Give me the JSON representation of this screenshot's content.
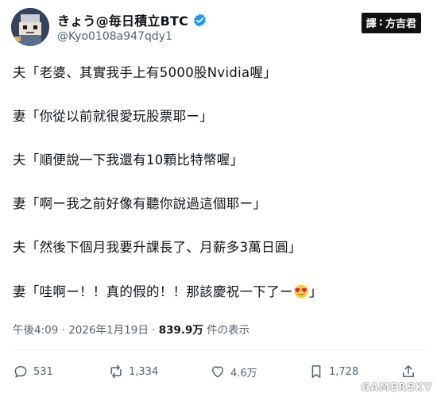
{
  "author": {
    "display_name": "きょう@毎日積立BTC",
    "handle": "@Kyo0108a947qdy1",
    "avatar_icon": "pixel-avatar-icon",
    "verified_icon": "verified-badge-icon",
    "verified_color": "#1d9bf0"
  },
  "translator": {
    "label": "譯",
    "sep": ":",
    "name": "方吉君"
  },
  "post": {
    "lines": [
      "夫「老婆、其實我手上有5000股Nvidia喔」",
      "妻「你從以前就很愛玩股票耶ー」",
      "夫「順便說一下我還有10顆比特幣喔」",
      "妻「啊ー我之前好像有聽你說過這個耶ー」",
      "夫「然後下個月我要升課長了、月薪多3萬日圓」"
    ],
    "last_line_before_emoji": "妻「哇啊ー！！真的假的！！那該慶祝一下了ー",
    "last_line_emoji": "heart-eyes-emoji",
    "last_line_after_emoji": "」"
  },
  "meta": {
    "timestamp": "午後4:09 · 2026年1月19日 · ",
    "views_count": "839.9万",
    "views_label": " 件の表示"
  },
  "actions": {
    "replies": "531",
    "reposts": "1,334",
    "likes": "4.6万",
    "bookmarks": "1,728"
  },
  "watermark": "GAMERSKY"
}
